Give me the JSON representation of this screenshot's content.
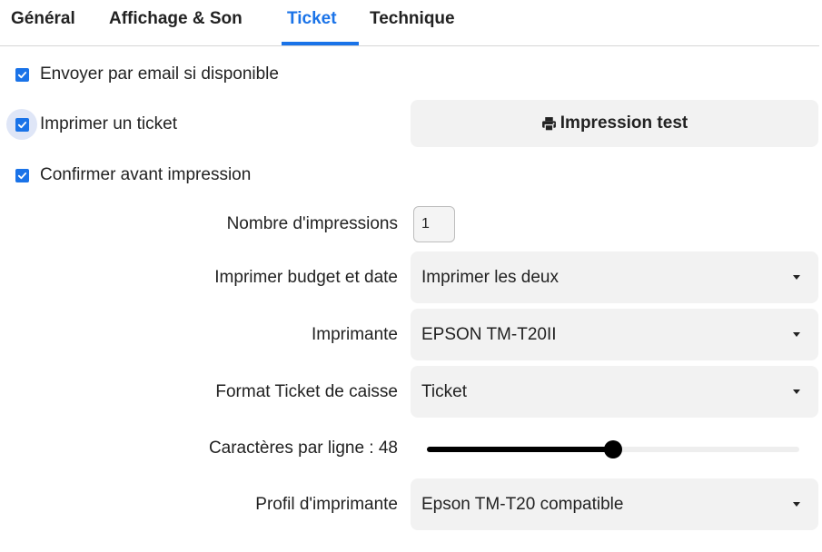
{
  "tabs": [
    {
      "label": "Général"
    },
    {
      "label": "Affichage & Son"
    },
    {
      "label": "Ticket"
    },
    {
      "label": "Technique"
    }
  ],
  "active_tab": "Ticket",
  "checkboxes": {
    "email": {
      "label": "Envoyer par email si disponible",
      "checked": true
    },
    "print": {
      "label": "Imprimer un ticket",
      "checked": true
    },
    "confirm": {
      "label": "Confirmer avant impression",
      "checked": true
    }
  },
  "test_print": {
    "label": "Impression test",
    "icon": "printer-icon"
  },
  "fields": {
    "copies": {
      "label": "Nombre d'impressions",
      "value": "1"
    },
    "budget_date": {
      "label": "Imprimer budget et date",
      "value": "Imprimer les deux"
    },
    "printer": {
      "label": "Imprimante",
      "value": "EPSON TM-T20II"
    },
    "receipt_format": {
      "label": "Format Ticket de caisse",
      "value": "Ticket"
    },
    "chars_per_line": {
      "label": "Caractères par ligne : 48",
      "fraction": 0.5
    },
    "printer_profile": {
      "label": "Profil d'imprimante",
      "value": "Epson TM-T20 compatible"
    }
  },
  "colors": {
    "accent": "#1a73e8",
    "field_bg": "#f2f2f2",
    "slider_fill": "#000000"
  }
}
